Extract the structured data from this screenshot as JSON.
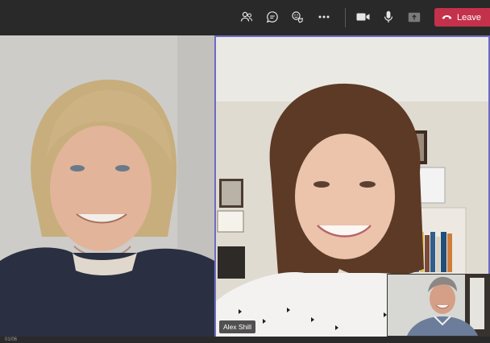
{
  "toolbar": {
    "icons": [
      "people-icon",
      "chat-icon",
      "reactions-icon",
      "more-options-icon",
      "camera-icon",
      "microphone-icon",
      "share-screen-icon"
    ],
    "leave_label": "Leave",
    "leave_color": "#c4314b"
  },
  "participants": {
    "active_speaker_name": "Alex Shill",
    "active_speaker_border": "#6f6ac1"
  },
  "footer": {
    "page_indicator": "01/06"
  }
}
